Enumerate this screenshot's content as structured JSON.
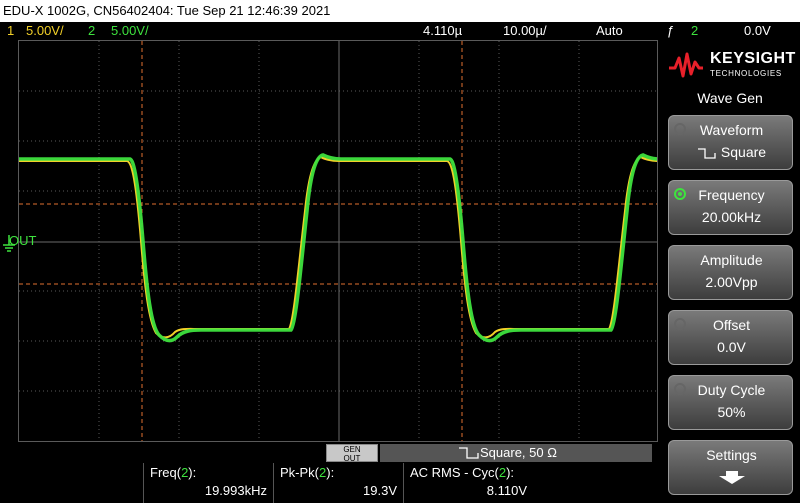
{
  "title_bar": "EDU-X 1002G, CN56402404: Tue Sep 21 12:46:39 2021",
  "status": {
    "ch1_num": "1",
    "ch1_scale": "5.00V/",
    "ch2_num": "2",
    "ch2_scale": "5.00V/",
    "time_offset": "4.110µ",
    "time_scale": "10.00µ/",
    "trigger_mode": "Auto",
    "trigger_icon": "ƒ",
    "trigger_channel": "2",
    "trigger_level": "0.0V"
  },
  "gen_out_marker": "OUT",
  "colors": {
    "ch1": "#f2d028",
    "ch2": "#3ee23e",
    "cursor": "#e07030",
    "grid": "#5a5a5a"
  },
  "side_panel": {
    "brand": "KEYSIGHT",
    "brand_sub": "TECHNOLOGIES",
    "title": "Wave Gen",
    "softkeys": [
      {
        "label": "Waveform",
        "value": "Square"
      },
      {
        "label": "Frequency",
        "value": "20.00kHz"
      },
      {
        "label": "Amplitude",
        "value": "2.00Vpp"
      },
      {
        "label": "Offset",
        "value": "0.0V"
      },
      {
        "label": "Duty Cycle",
        "value": "50%"
      },
      {
        "label": "Settings",
        "value": ""
      }
    ]
  },
  "gen_button": {
    "line1": "GEN",
    "line2": "OUT"
  },
  "gen_status": "Square, 50 Ω",
  "measurements": [
    {
      "label": "Freq(",
      "ch": "2",
      "close": "):",
      "value": "19.993kHz"
    },
    {
      "label": "Pk-Pk(",
      "ch": "2",
      "close": "):",
      "value": "19.3V"
    },
    {
      "label": "AC RMS - Cyc(",
      "ch": "2",
      "close": "):",
      "value": "8.110V"
    }
  ]
}
